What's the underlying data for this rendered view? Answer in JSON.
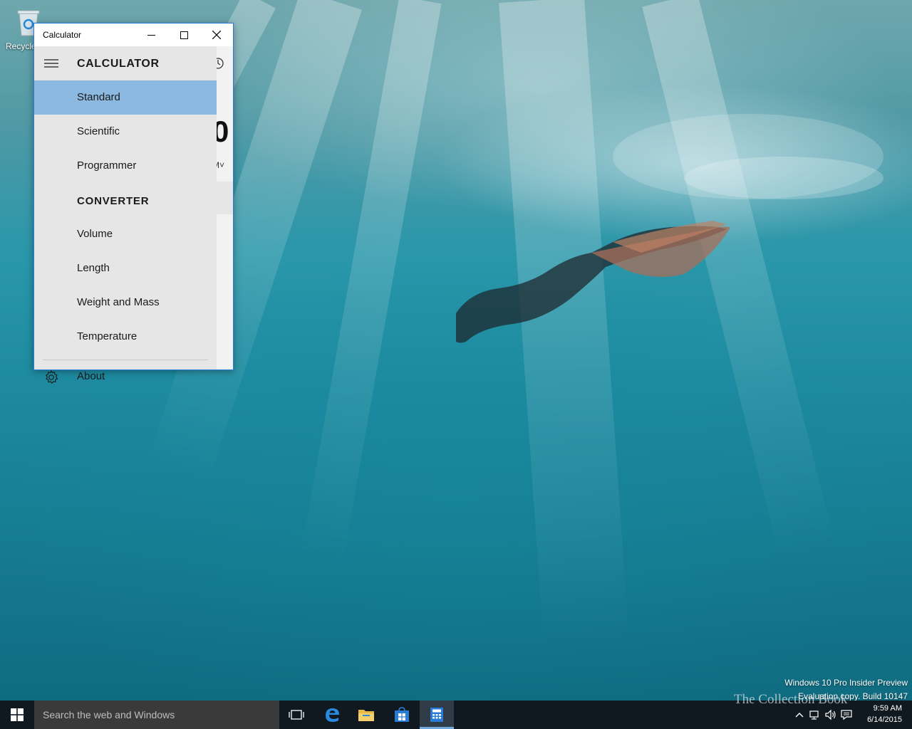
{
  "desktop": {
    "recycle_bin_label": "Recycle",
    "watermark_line1": "Windows 10 Pro Insider Preview",
    "watermark_line2": "Evaluation copy. Build 10147",
    "brand_text": "The Collection Book"
  },
  "window": {
    "title": "Calculator",
    "background_display": "0",
    "memory_hint": "M˅"
  },
  "nav": {
    "header_title": "CALCULATOR",
    "items": [
      {
        "label": "Standard",
        "selected": true
      },
      {
        "label": "Scientific"
      },
      {
        "label": "Programmer"
      }
    ],
    "converter_title": "CONVERTER",
    "converter_items": [
      {
        "label": "Volume"
      },
      {
        "label": "Length"
      },
      {
        "label": "Weight and Mass"
      },
      {
        "label": "Temperature"
      }
    ],
    "about_label": "About"
  },
  "taskbar": {
    "search_placeholder": "Search the web and Windows",
    "time": "9:59 AM",
    "date": "6/14/2015"
  },
  "colors": {
    "accent": "#2a7bd5",
    "selected_item": "#8cb9e0",
    "taskbar": "#101820"
  }
}
